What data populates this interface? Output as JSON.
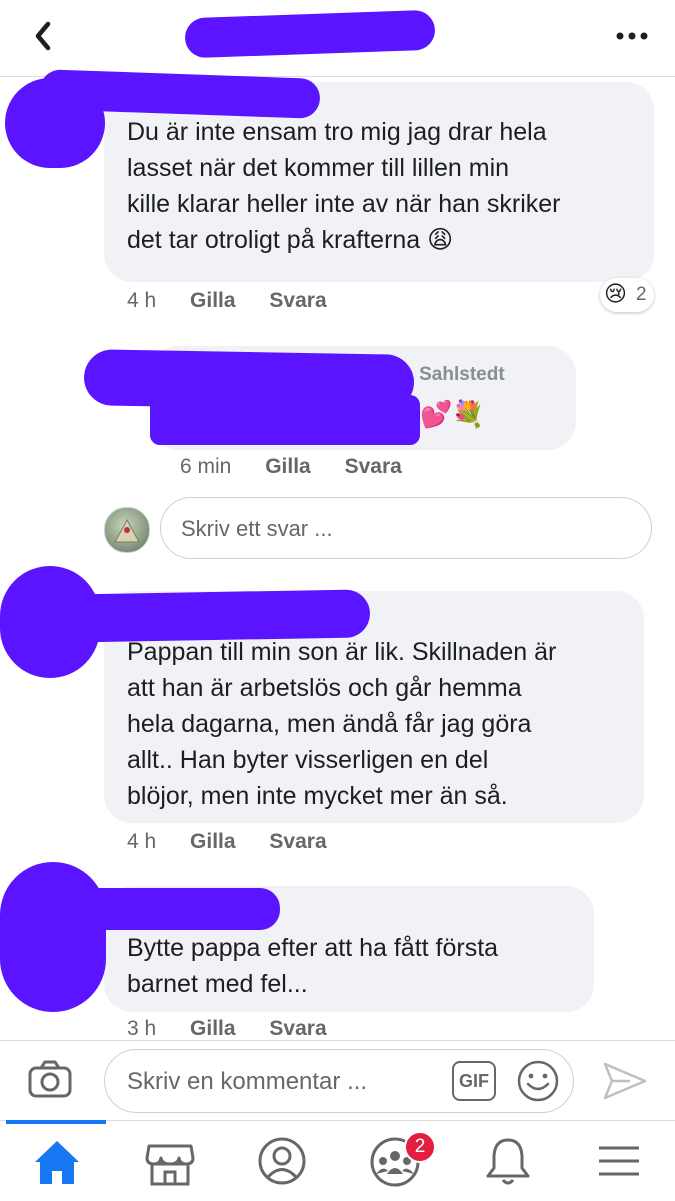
{
  "header": {
    "back_icon": "chevron-left-icon",
    "more_icon": "more-dots-icon"
  },
  "comments": [
    {
      "text": "Du är inte ensam tro mig jag drar hela\nlasset när det kommer till lillen min\nkille klarar heller inte av när han skriker\ndet tar otroligt på krafterna 😩",
      "time": "4 h",
      "like": "Gilla",
      "reply": "Svara",
      "reaction": {
        "emoji": "😢",
        "count": "2"
      }
    },
    {
      "faded_name": "...lena Sahlstedt",
      "text": "💕💐",
      "time": "6 min",
      "like": "Gilla",
      "reply": "Svara"
    },
    {
      "text": "Pappan till min son är lik. Skillnaden är\natt han är arbetslös och går hemma\nhela dagarna, men ändå får jag göra\nallt..  Han byter visserligen en del\nblöjor, men inte mycket mer än så.",
      "time": "4 h",
      "like": "Gilla",
      "reply": "Svara"
    },
    {
      "text": "Bytte pappa efter att ha fått första\nbarnet med fel...",
      "time": "3 h",
      "like": "Gilla",
      "reply": "Svara"
    }
  ],
  "reply_box": {
    "placeholder": "Skriv ett svar ..."
  },
  "comment_bar": {
    "placeholder": "Skriv en kommentar ...",
    "gif_label": "GIF"
  },
  "nav": {
    "items": [
      "home-icon",
      "marketplace-icon",
      "profile-icon",
      "groups-icon",
      "bell-icon",
      "menu-icon"
    ],
    "groups_badge": "2",
    "active_color": "#1877f2",
    "scribble_color": "#5a14ff"
  }
}
